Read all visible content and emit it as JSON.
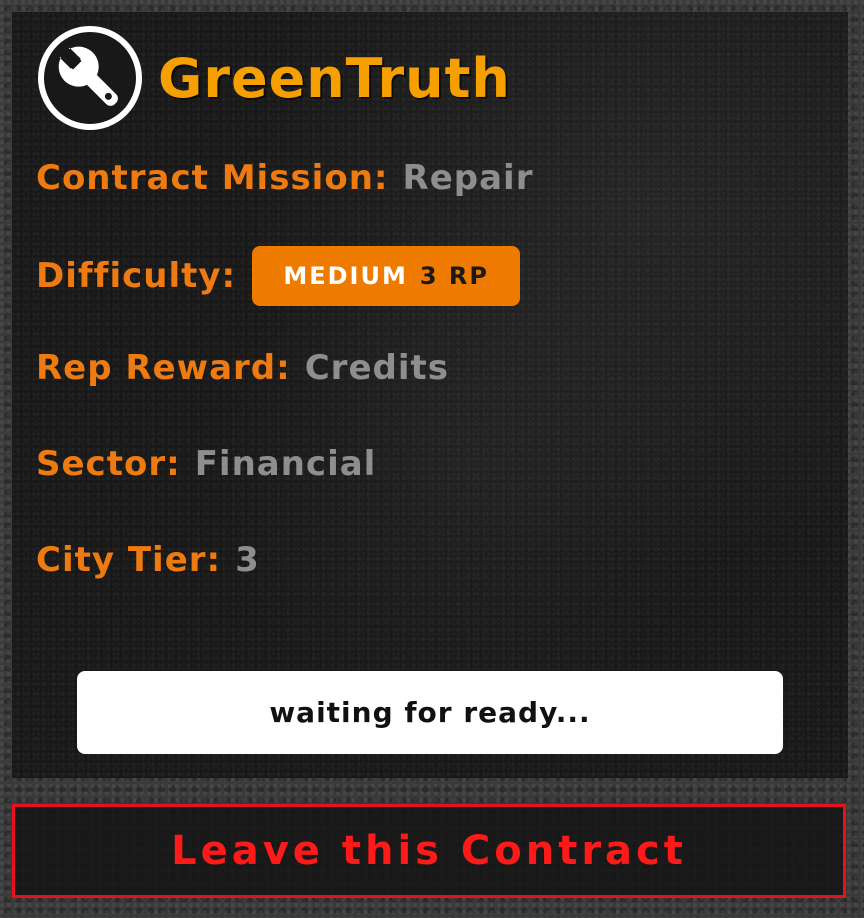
{
  "header": {
    "title": "GreenTruth",
    "logo_icon": "wrench-icon"
  },
  "details": {
    "mission": {
      "label": "Contract Mission:",
      "value": "Repair"
    },
    "difficulty": {
      "label": "Difficulty:",
      "level": "MEDIUM",
      "rp": "3 RP"
    },
    "reward": {
      "label": "Rep Reward:",
      "value": "Credits"
    },
    "sector": {
      "label": "Sector:",
      "value": "Financial"
    },
    "city_tier": {
      "label": "City Tier:",
      "value": "3"
    }
  },
  "actions": {
    "ready_label": "waiting for ready...",
    "leave_label": "Leave this Contract"
  },
  "colors": {
    "accent": "#ee7a12",
    "title": "#f5a000",
    "badge": "#ef7a00",
    "value": "#8e8e8e",
    "leave": "#ff1a1a"
  }
}
